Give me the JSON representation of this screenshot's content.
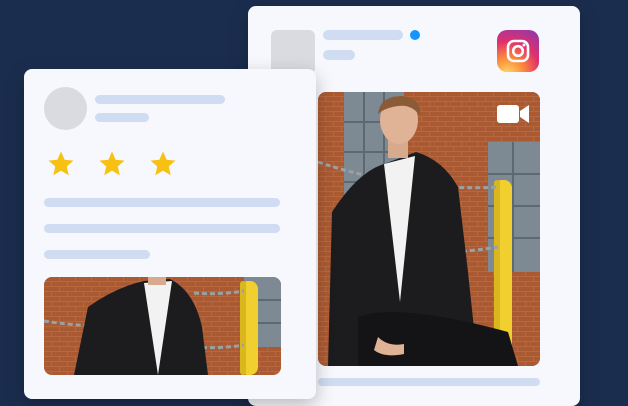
{
  "stars": {
    "value": 3,
    "max": 3,
    "color": "#f7c114"
  },
  "icons": {
    "instagram": "instagram-icon",
    "video": "video-camera-icon"
  },
  "colors": {
    "background": "#1b2d4f",
    "card": "#f6f8fd",
    "skeleton": "#cfdcf1",
    "placeholder": "#d9dbe1",
    "online_dot": "#1495ff"
  }
}
